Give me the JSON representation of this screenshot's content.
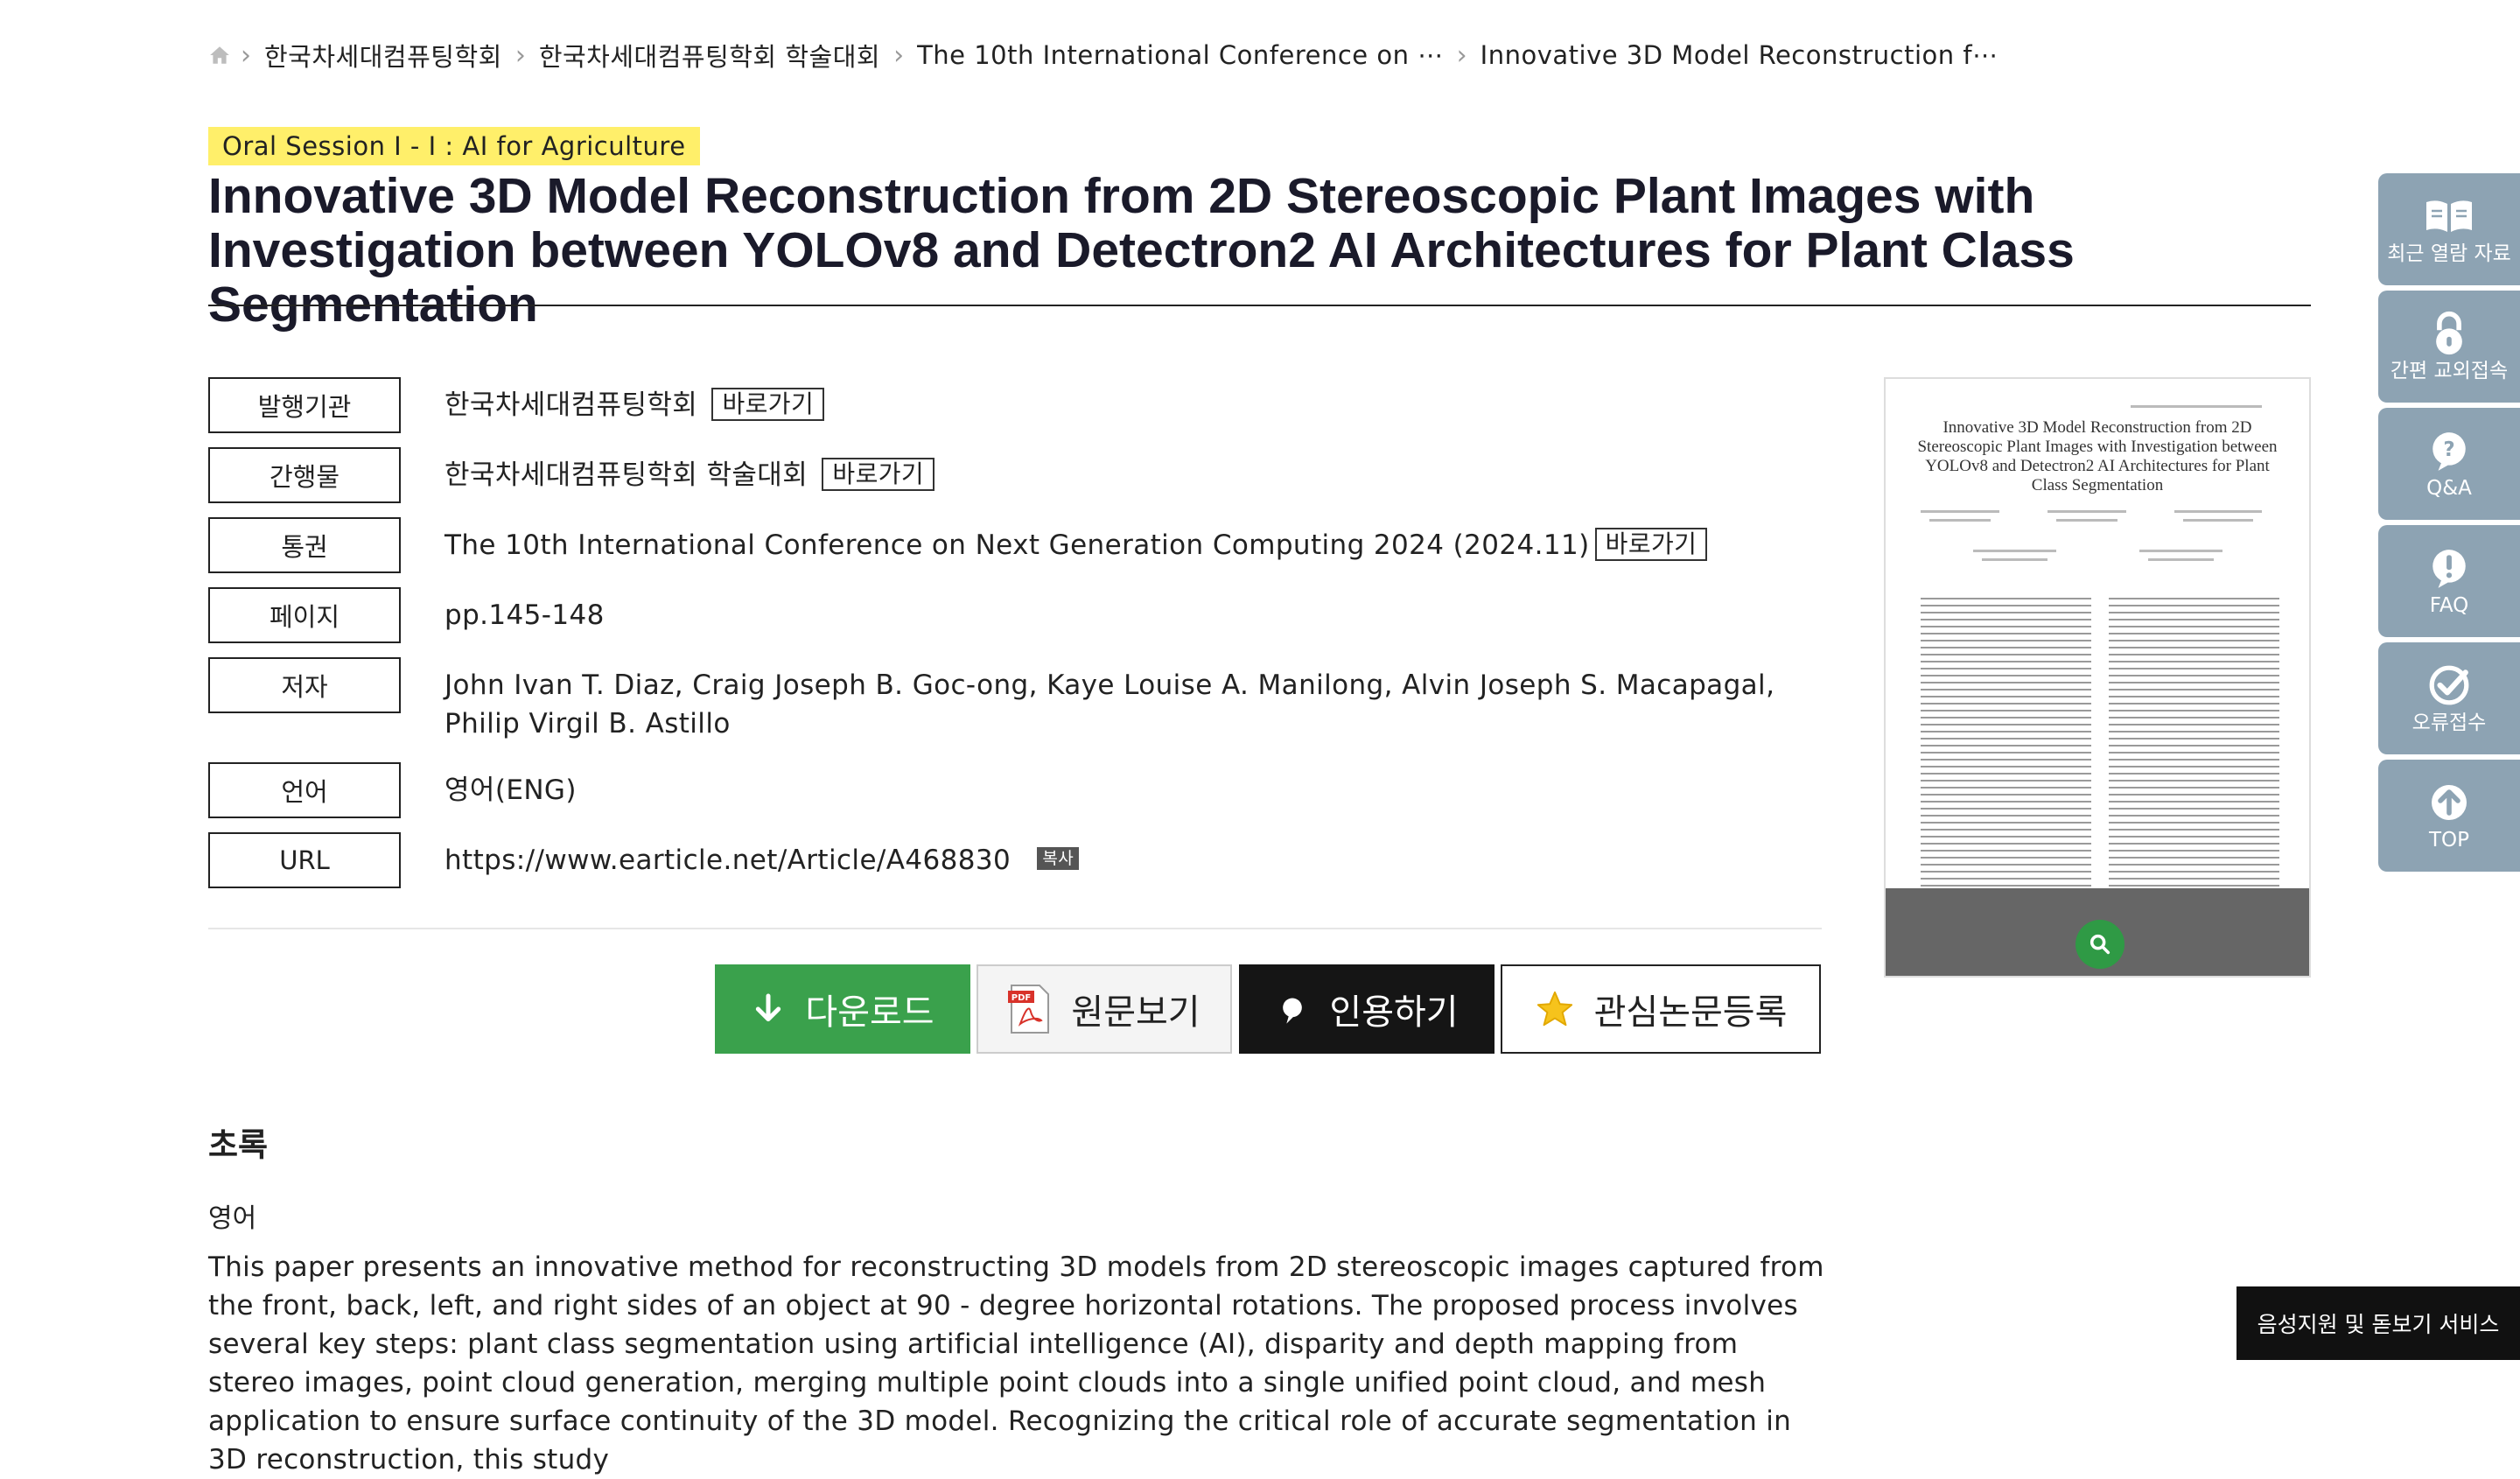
{
  "breadcrumb": {
    "items": [
      {
        "label": "한국차세대컴퓨팅학회"
      },
      {
        "label": "한국차세대컴퓨팅학회 학술대회"
      },
      {
        "label": "The 10th International Conference on ⋯"
      },
      {
        "label": "Innovative 3D Model Reconstruction f⋯"
      }
    ]
  },
  "article": {
    "session": "Oral Session I - I : AI for Agriculture",
    "title": "Innovative 3D Model Reconstruction from 2D Stereoscopic Plant Images with Investigation between YOLOv8 and Detectron2 AI Architectures for Plant Class Segmentation"
  },
  "meta": {
    "goto_label": "바로가기",
    "copy_label": "복사",
    "publisher": {
      "label": "발행기관",
      "value": "한국차세대컴퓨팅학회"
    },
    "publication": {
      "label": "간행물",
      "value": "한국차세대컴퓨팅학회 학술대회"
    },
    "volume": {
      "label": "통권",
      "value": "The 10th International Conference on Next Generation Computing 2024 (2024.11)"
    },
    "pages": {
      "label": "페이지",
      "value": "pp.145-148"
    },
    "authors": {
      "label": "저자",
      "value": "John Ivan T. Diaz, Craig Joseph B. Goc-ong, Kaye Louise A. Manilong, Alvin Joseph S. Macapagal, Philip Virgil B. Astillo"
    },
    "language": {
      "label": "언어",
      "value": "영어(ENG)"
    },
    "url": {
      "label": "URL",
      "value": "https://www.earticle.net/Article/A468830"
    }
  },
  "preview": {
    "title": "Innovative 3D Model Reconstruction from 2D Stereoscopic Plant Images with Investigation between YOLOv8 and Detectron2 AI Architectures for Plant Class Segmentation"
  },
  "actions": {
    "download": "다운로드",
    "original": "원문보기",
    "cite": "인용하기",
    "favorite": "관심논문등록",
    "pdf_badge": "PDF"
  },
  "abstract": {
    "heading": "초록",
    "language": "영어",
    "text": "This paper presents an innovative method for reconstructing 3D models from 2D stereoscopic images captured from the front, back, left, and right sides of an object at 90 - degree horizontal rotations. The proposed process involves several key steps: plant class segmentation using artificial intelligence (AI), disparity and depth mapping from stereo images, point cloud generation, merging multiple point clouds into a single unified point cloud, and mesh application to ensure surface continuity of the 3D model. Recognizing the critical role of accurate segmentation in 3D reconstruction, this study"
  },
  "quick_menu": {
    "items": [
      {
        "label": "최근 열람 자료",
        "icon": "book-icon"
      },
      {
        "label": "간편 교외접속",
        "icon": "lock-icon"
      },
      {
        "label": "Q&A",
        "icon": "question-bubble-icon"
      },
      {
        "label": "FAQ",
        "icon": "exclamation-bubble-icon"
      },
      {
        "label": "오류접수",
        "icon": "check-circle-icon"
      },
      {
        "label": "TOP",
        "icon": "arrow-up-icon"
      }
    ]
  },
  "accessibility": {
    "label": "음성지원 및 돋보기 서비스"
  },
  "colors": {
    "badge": "#ffef6a",
    "download": "#3aa14c",
    "cite": "#151515",
    "quick_menu": "#8da3b3"
  }
}
